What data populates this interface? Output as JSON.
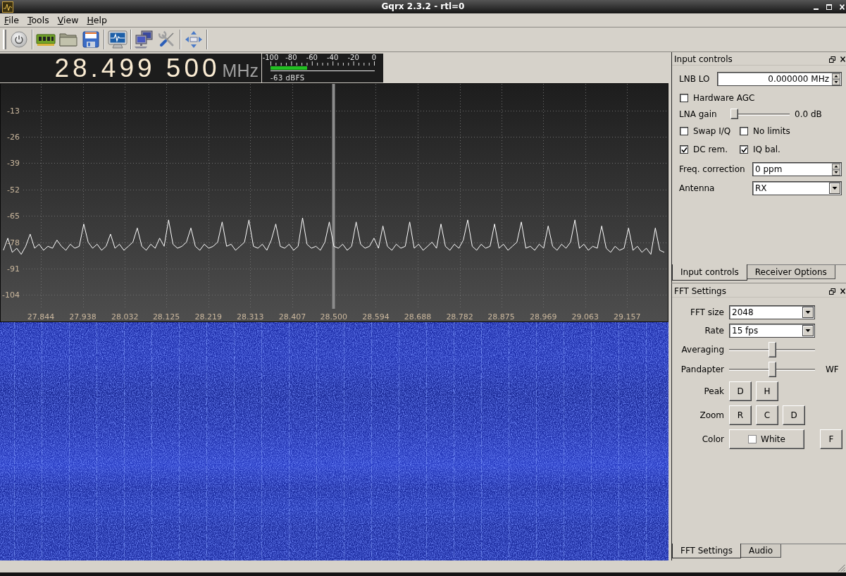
{
  "window": {
    "title": "Gqrx 2.3.2 - rtl=0"
  },
  "menu": [
    "File",
    "Tools",
    "View",
    "Help"
  ],
  "frequency": {
    "value": "28.499 500",
    "unit": "MHz"
  },
  "signal_meter": {
    "scale": [
      "-100",
      "-80",
      "-60",
      "-40",
      "-20",
      "0"
    ],
    "level": 0.35,
    "reading": "-63 dBFS"
  },
  "spectrum": {
    "chart_data": [
      {
        "type": "line",
        "xlim": [
          27.7525,
          29.2495
        ],
        "ylim": [
          -117.5,
          0.5
        ],
        "xticks": [
          {
            "value": 27.844,
            "label": "27.844"
          },
          {
            "value": 27.938,
            "label": "27.938"
          },
          {
            "value": 28.032,
            "label": "28.032"
          },
          {
            "value": 28.125,
            "label": "28.125"
          },
          {
            "value": 28.219,
            "label": "28.219"
          },
          {
            "value": 28.313,
            "label": "28.313"
          },
          {
            "value": 28.407,
            "label": "28.407"
          },
          {
            "value": 28.5,
            "label": "28.500"
          },
          {
            "value": 28.594,
            "label": "28.594"
          },
          {
            "value": 28.688,
            "label": "28.688"
          },
          {
            "value": 28.782,
            "label": "28.782"
          },
          {
            "value": 28.875,
            "label": "28.875"
          },
          {
            "value": 28.969,
            "label": "28.969"
          },
          {
            "value": 29.063,
            "label": "29.063"
          },
          {
            "value": 29.157,
            "label": "29.157"
          }
        ],
        "yticks": [
          -13,
          -26,
          -39,
          -52,
          -65,
          -78,
          -91,
          -104
        ],
        "grid": true,
        "color": "#ffffff",
        "ref_lines": [
          {
            "axis": "x",
            "value": 28.4995,
            "color": "#8c8c8c"
          }
        ],
        "x": [
          27.76,
          27.77,
          27.78,
          27.79,
          27.8,
          27.81,
          27.82,
          27.83,
          27.84,
          27.85,
          27.86,
          27.87,
          27.88,
          27.89,
          27.9,
          27.91,
          27.92,
          27.93,
          27.94,
          27.95,
          27.96,
          27.97,
          27.98,
          27.99,
          28,
          28.01,
          28.02,
          28.03,
          28.04,
          28.05,
          28.06,
          28.07,
          28.08,
          28.09,
          28.1,
          28.11,
          28.12,
          28.13,
          28.14,
          28.15,
          28.16,
          28.17,
          28.18,
          28.19,
          28.2,
          28.21,
          28.22,
          28.23,
          28.24,
          28.25,
          28.26,
          28.27,
          28.28,
          28.29,
          28.3,
          28.31,
          28.32,
          28.33,
          28.34,
          28.35,
          28.36,
          28.37,
          28.38,
          28.39,
          28.4,
          28.41,
          28.42,
          28.43,
          28.44,
          28.45,
          28.46,
          28.47,
          28.48,
          28.49,
          28.5,
          28.51,
          28.52,
          28.53,
          28.54,
          28.55,
          28.56,
          28.57,
          28.58,
          28.59,
          28.6,
          28.61,
          28.62,
          28.63,
          28.64,
          28.65,
          28.66,
          28.67,
          28.68,
          28.69,
          28.7,
          28.71,
          28.72,
          28.73,
          28.74,
          28.75,
          28.76,
          28.77,
          28.78,
          28.79,
          28.8,
          28.81,
          28.82,
          28.83,
          28.84,
          28.85,
          28.86,
          28.87,
          28.88,
          28.89,
          28.9,
          28.91,
          28.92,
          28.93,
          28.94,
          28.95,
          28.96,
          28.97,
          28.98,
          28.99,
          29,
          29.01,
          29.02,
          29.03,
          29.04,
          29.05,
          29.06,
          29.07,
          29.08,
          29.09,
          29.1,
          29.11,
          29.12,
          29.13,
          29.14,
          29.15,
          29.16,
          29.17,
          29.18,
          29.19,
          29.2,
          29.21,
          29.22,
          29.23,
          29.24
        ],
        "values": [
          -82,
          -76,
          -83,
          -81,
          -84,
          -80,
          -74,
          -81,
          -79,
          -82,
          -80,
          -81,
          -77,
          -80,
          -82,
          -79,
          -81,
          -80,
          -69,
          -78,
          -81,
          -79,
          -82,
          -80,
          -74,
          -81,
          -79,
          -82,
          -80,
          -78,
          -71,
          -80,
          -82,
          -79,
          -81,
          -76,
          -80,
          -67,
          -79,
          -81,
          -80,
          -78,
          -71,
          -80,
          -82,
          -79,
          -81,
          -80,
          -78,
          -68,
          -80,
          -79,
          -82,
          -80,
          -78,
          -67,
          -80,
          -81,
          -79,
          -82,
          -77,
          -69,
          -80,
          -81,
          -79,
          -82,
          -80,
          -66,
          -79,
          -81,
          -80,
          -82,
          -78,
          -68,
          -80,
          -81,
          -79,
          -82,
          -80,
          -68,
          -79,
          -81,
          -80,
          -76,
          -81,
          -70,
          -80,
          -82,
          -79,
          -81,
          -80,
          -68,
          -81,
          -79,
          -82,
          -80,
          -78,
          -81,
          -69,
          -80,
          -82,
          -79,
          -81,
          -77,
          -67,
          -80,
          -82,
          -79,
          -81,
          -80,
          -69,
          -81,
          -79,
          -82,
          -80,
          -78,
          -68,
          -81,
          -80,
          -82,
          -79,
          -81,
          -70,
          -80,
          -82,
          -79,
          -81,
          -78,
          -67,
          -81,
          -79,
          -82,
          -80,
          -81,
          -70,
          -81,
          -83,
          -80,
          -82,
          -81,
          -71,
          -82,
          -80,
          -83,
          -81,
          -84,
          -71,
          -82,
          -83
        ]
      }
    ]
  },
  "input_controls": {
    "title": "Input controls",
    "lnb_lo": {
      "label": "LNB LO",
      "value": "0.000000 MHz"
    },
    "hardware_agc": {
      "label": "Hardware AGC",
      "checked": false
    },
    "lna_gain": {
      "label": "LNA gain",
      "level": 0,
      "reading": "0.0 dB"
    },
    "options": [
      {
        "label": "Swap I/Q",
        "checked": false
      },
      {
        "label": "No limits",
        "checked": false
      },
      {
        "label": "DC rem.",
        "checked": true
      },
      {
        "label": "IQ bal.",
        "checked": true
      }
    ],
    "freq_correction": {
      "label": "Freq. correction",
      "value": "0 ppm"
    },
    "antenna": {
      "label": "Antenna",
      "value": "RX"
    },
    "tabs": [
      {
        "label": "Input controls",
        "selected": true
      },
      {
        "label": "Receiver Options",
        "selected": false
      }
    ]
  },
  "fft_settings": {
    "title": "FFT Settings",
    "fft_size": {
      "label": "FFT size",
      "value": "2048"
    },
    "rate": {
      "label": "Rate",
      "value": "15 fps"
    },
    "averaging": {
      "label": "Averaging",
      "level": 0.5
    },
    "pandapter": {
      "label": "Pandapter",
      "level": 0.5,
      "end_label": "WF"
    },
    "peak": {
      "label": "Peak",
      "buttons": [
        "D",
        "H"
      ]
    },
    "zoom": {
      "label": "Zoom",
      "buttons": [
        "R",
        "C",
        "D"
      ]
    },
    "color": {
      "label": "Color",
      "color": "#ffffff",
      "value": "White",
      "side_button": "F"
    },
    "tabs": [
      {
        "label": "FFT Settings",
        "selected": true
      },
      {
        "label": "Audio",
        "selected": false
      }
    ]
  }
}
